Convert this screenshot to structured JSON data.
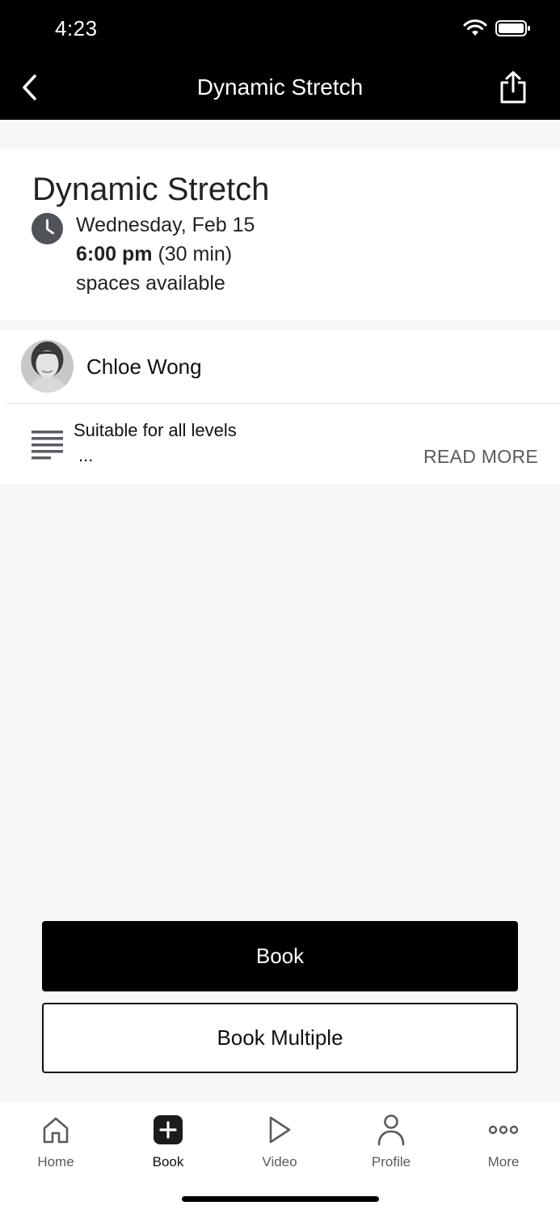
{
  "status_bar": {
    "time": "4:23"
  },
  "nav": {
    "title": "Dynamic Stretch"
  },
  "class_info": {
    "title": "Dynamic Stretch",
    "date": "Wednesday, Feb 15",
    "time": "6:00 pm",
    "duration": "(30 min)",
    "availability": "spaces available"
  },
  "instructor": {
    "name": "Chloe Wong"
  },
  "description": {
    "text": "Suitable for all levels",
    "ellipsis": "...",
    "read_more_label": "READ MORE"
  },
  "actions": {
    "book_label": "Book",
    "book_multiple_label": "Book Multiple"
  },
  "tabbar": {
    "items": [
      {
        "label": "Home",
        "icon": "home-icon",
        "active": false
      },
      {
        "label": "Book",
        "icon": "plus-square-icon",
        "active": true
      },
      {
        "label": "Video",
        "icon": "play-icon",
        "active": false
      },
      {
        "label": "Profile",
        "icon": "person-icon",
        "active": false
      },
      {
        "label": "More",
        "icon": "more-dots-icon",
        "active": false
      }
    ]
  },
  "colors": {
    "topbar": "#000000",
    "page_bg": "#f6f7f9",
    "card_bg": "#ffffff",
    "primary_button": "#000000"
  }
}
